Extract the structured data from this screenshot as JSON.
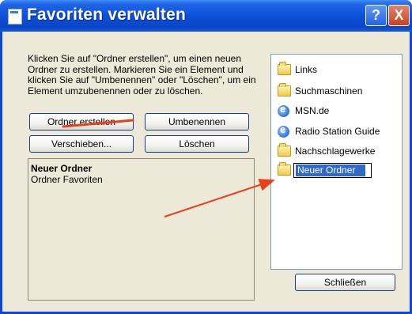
{
  "window": {
    "title": "Favoriten verwalten"
  },
  "titlebar": {
    "help_label": "?",
    "close_label": "X"
  },
  "description": "Klicken Sie auf \"Ordner erstellen\", um einen neuen Ordner zu erstellen. Markieren Sie ein Element und klicken Sie auf \"Umbenennen\" oder \"Löschen\", um ein Element umzubenennen oder zu löschen.",
  "buttons": {
    "create_folder": "Ordner erstellen",
    "rename": "Umbenennen",
    "move": "Verschieben...",
    "delete": "Löschen",
    "close": "Schließen"
  },
  "preview": {
    "name": "Neuer Ordner",
    "location": "Ordner Favoriten"
  },
  "tree": {
    "items": [
      {
        "label": "Links",
        "icon": "folder-icon"
      },
      {
        "label": "Suchmaschinen",
        "icon": "folder-icon"
      },
      {
        "label": "MSN.de",
        "icon": "ie-link-icon"
      },
      {
        "label": "Radio Station Guide",
        "icon": "ie-link-icon"
      },
      {
        "label": "Nachschlagewerke",
        "icon": "folder-icon"
      }
    ],
    "editing_item": {
      "value": "Neuer Ordner",
      "icon": "folder-icon"
    }
  },
  "annotations": {
    "arrow_color": "#e8401c"
  },
  "colors": {
    "titlebar": "#0b4fd8",
    "dialog_bg": "#ece9d8",
    "selection": "#316ac5"
  }
}
